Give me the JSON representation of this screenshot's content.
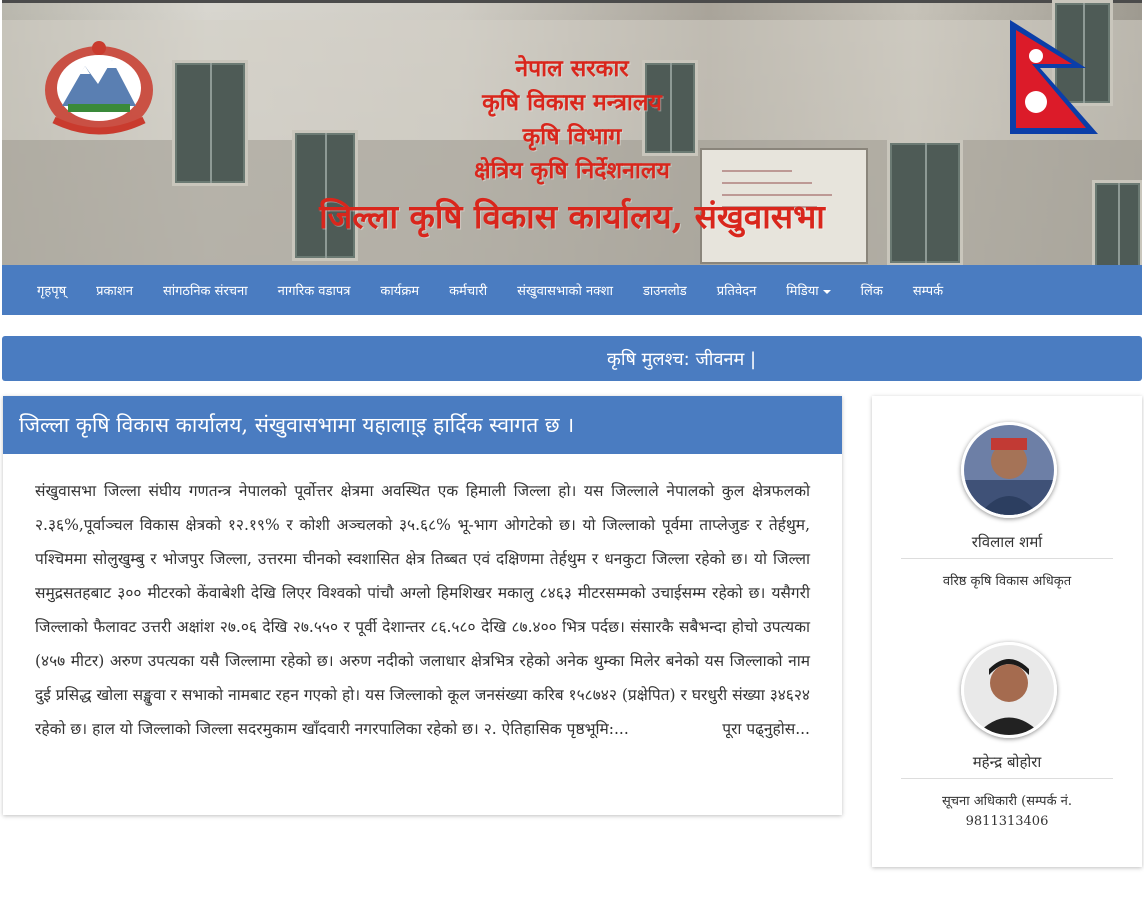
{
  "header": {
    "title_lines": [
      "नेपाल सरकार",
      "कृषि विकास मन्त्रालय",
      "कृषि विभाग",
      "क्षेत्रिय कृषि निर्देशनालय"
    ],
    "office_name": "जिल्ला कृषि विकास कार्यालय, संखुवासभा"
  },
  "nav": {
    "items": [
      "गृहपृष्",
      "प्रकाशन",
      "सांगठनिक संरचना",
      "नागरिक वडापत्र",
      "कार्यक्रम",
      "कर्मचारी",
      "संखुवासभाको नक्शा",
      "डाउनलोड",
      "प्रतिवेदन",
      "मिडिया",
      "लिंक",
      "सम्पर्क"
    ]
  },
  "motto": "कृषि मुलश्च: जीवनम |",
  "welcome": {
    "heading": "जिल्ला कृषि विकास कार्यालय, संखुवासभामा यहालाा्इ हार्दिक स्वागत छ ।",
    "body": "संखुवासभा जिल्ला संघीय गणतन्त्र नेपालको पूर्वोत्तर क्षेत्रमा अवस्थित एक हिमाली जिल्ला हो। यस जिल्लाले नेपालको कुल क्षेत्रफलको २.३६%,पूर्वाञ्चल विकास क्षेत्रको १२.१९% र कोशी अञ्चलको ३५.६८% भू-भाग ओगटेको छ। यो जिल्लाको पूर्वमा ताप्लेजुङ र तेर्हथुम, पश्चिममा सोलुखुम्बु र भोजपुर जिल्ला, उत्तरमा चीनको स्वशासित क्षेत्र तिब्बत एवं दक्षिणमा तेर्हथुम र धनकुटा जिल्ला रहेको छ। यो जिल्ला समुद्रसतहबाट ३०० मीटरको केंवाबेशी देखि लिएर विश्वको पांचौ अग्लो हिमशिखर मकालु ८४६३ मीटरसम्मको उचाईसम्म रहेको छ। यसैगरी जिल्लाको फैलावट उत्तरी अक्षांश २७.०६ देखि २७.५५० र पूर्वी देशान्तर ८६.५८० देखि ८७.४०० भित्र पर्दछ। संसारकै सबैभन्दा होचो उपत्यका (४५७ मीटर) अरुण उपत्यका यसै जिल्लामा रहेको छ। अरुण नदीको जलाधार क्षेत्रभित्र रहेको अनेक थुम्का मिलेर बनेको यस जिल्लाको नाम दुई प्रसिद्ध खोला सङ्खुवा र सभाको नामबाट रहन गएको हो। यस जिल्लाको कूल जनसंख्या करिब १५८७४२ (प्रक्षेपित) र घरधुरी संख्या ३४६२४ रहेको छ। हाल यो जिल्लाको जिल्ला सदरमुकाम खाँदवारी नगरपालिका रहेको छ। २. ऐतिहासिक पृष्ठभूमि:...",
    "read_more": "पूरा पढ्नुहोस..."
  },
  "staff": [
    {
      "name": "रविलाल शर्मा",
      "role": "वरिष्ठ कृषि विकास अधिकृत"
    },
    {
      "name": "महेन्द्र बोहोरा",
      "role": "सूचना अधिकारी (सम्पर्क नं. 9811313406"
    }
  ],
  "colors": {
    "brand_blue": "#4a7cc1",
    "title_red": "#d9261c"
  },
  "icons": {
    "emblem": "nepal-emblem-icon",
    "flag": "nepal-flag-icon",
    "dropdown": "caret-down-icon"
  }
}
